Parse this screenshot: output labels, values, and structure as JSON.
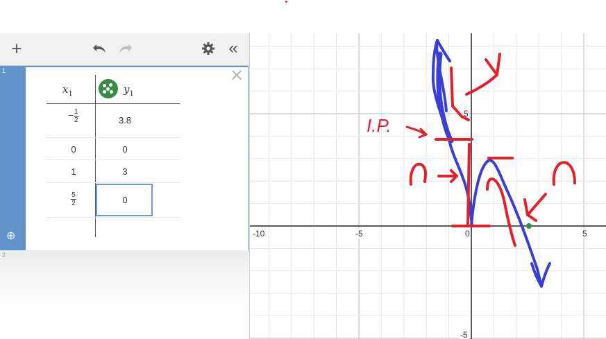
{
  "toolbar": {
    "add_icon": "plus-icon",
    "undo_icon": "undo-icon",
    "redo_icon": "redo-icon",
    "settings_icon": "gear-icon",
    "collapse_icon": "double-chevron-left-icon"
  },
  "expressions": [
    {
      "index": "1",
      "type": "table",
      "columns": [
        {
          "header_var": "x",
          "header_sub": "1"
        },
        {
          "header_var": "y",
          "header_sub": "1",
          "point_color": "#388c46"
        }
      ],
      "rows": [
        {
          "x": {
            "sign": "−",
            "num": "1",
            "den": "2"
          },
          "y": "3.8"
        },
        {
          "x": "0",
          "y": "0"
        },
        {
          "x": "1",
          "y": "3"
        },
        {
          "x": {
            "sign": "",
            "num": "5",
            "den": "2"
          },
          "y": "0"
        }
      ]
    },
    {
      "index": "2"
    }
  ],
  "graph": {
    "x_tick_labels": [
      "-10",
      "-5",
      "0",
      "5"
    ],
    "y_tick_labels": [
      "5",
      "-5"
    ],
    "annotation_text": "I.P."
  },
  "colors": {
    "accent_blue": "#5f93c9",
    "point_green": "#388c46",
    "ink_blue": "#3b3fd1",
    "ink_red": "#e3212d"
  }
}
